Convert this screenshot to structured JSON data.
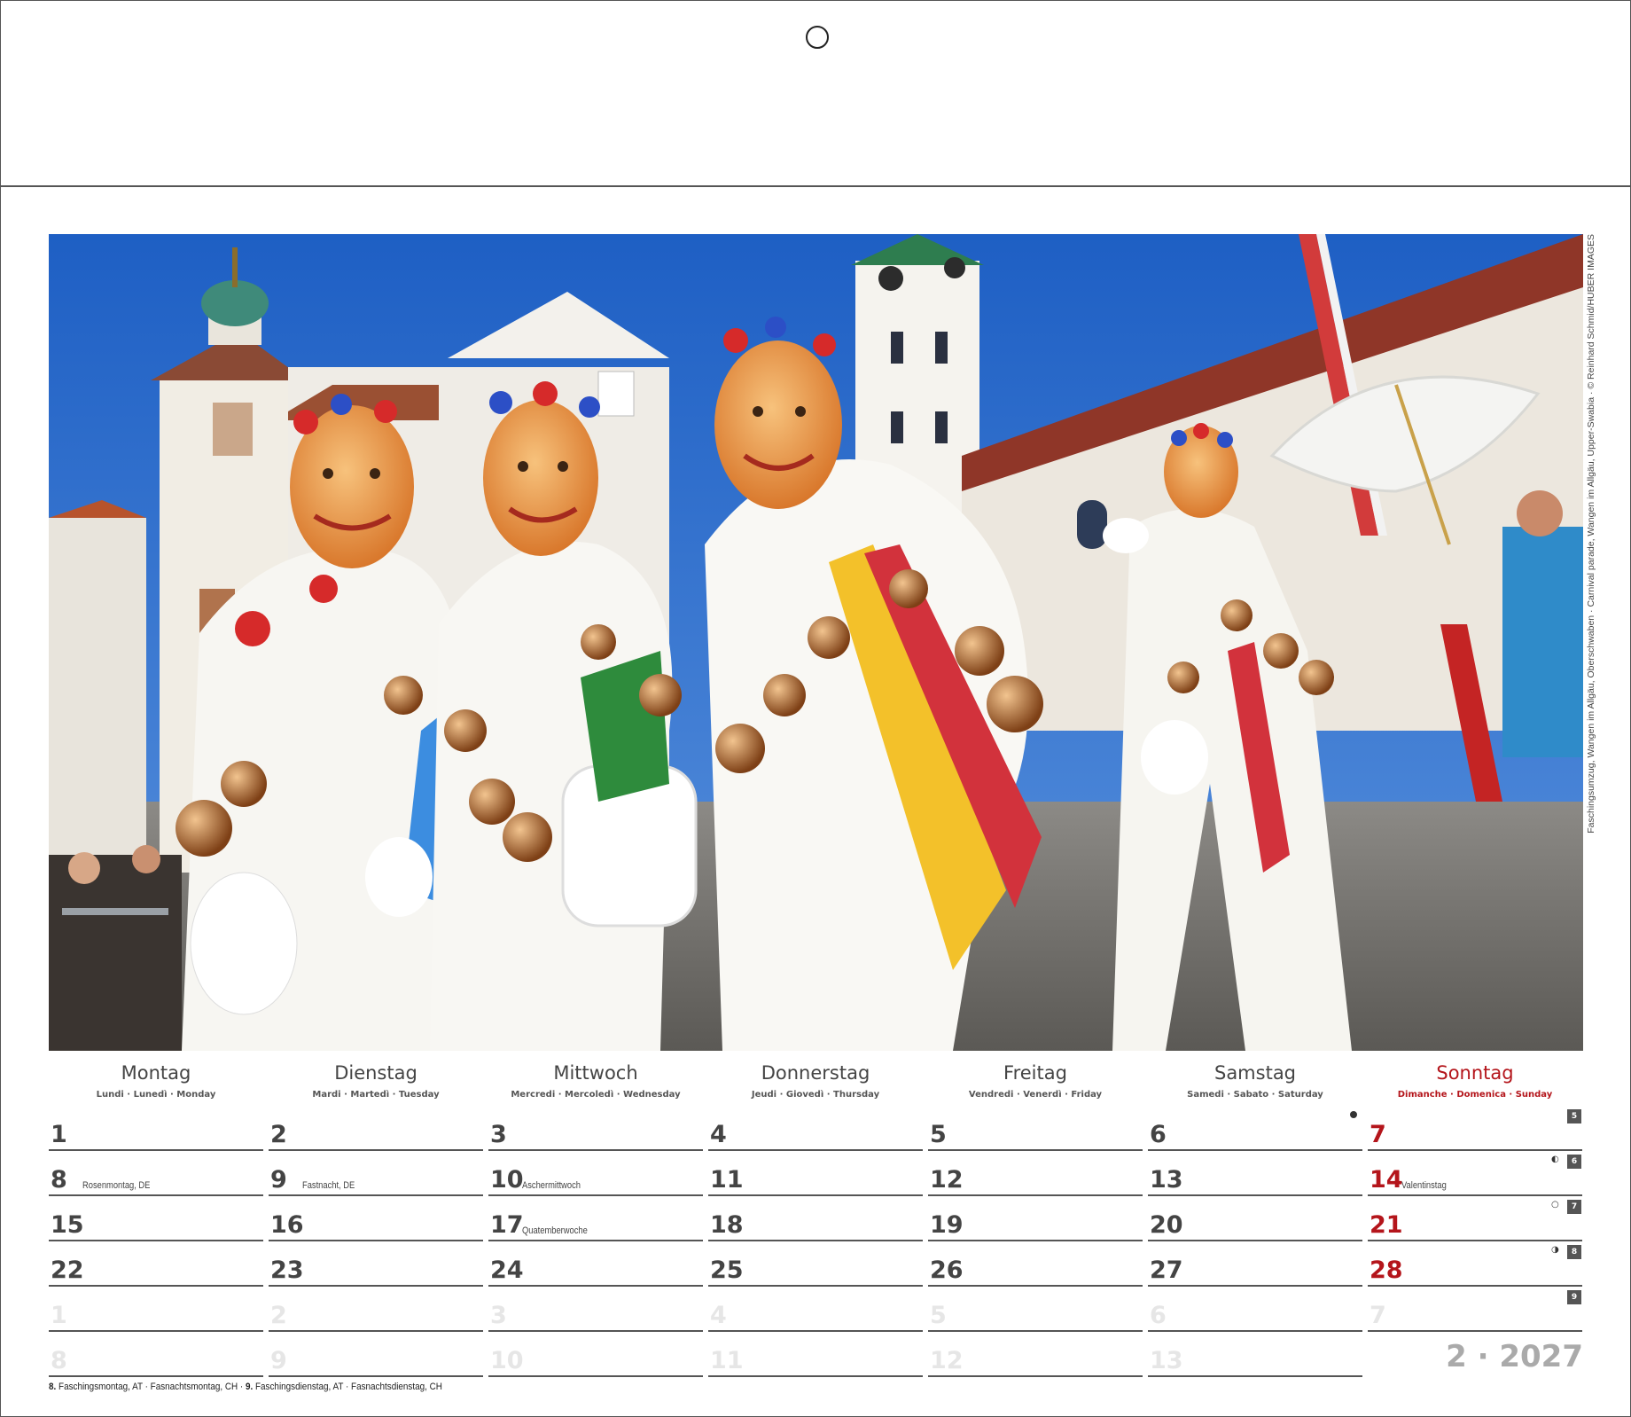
{
  "credit": "Faschingsumzug, Wangen im Allgäu, Oberschwaben · Carnival parade, Wangen im Allgäu, Upper-Swabia · © Reinhard Schmid/HUBER IMAGES",
  "weekdays": [
    {
      "name": "Montag",
      "sub": "Lundi · Lunedì · Monday"
    },
    {
      "name": "Dienstag",
      "sub": "Mardi · Martedì · Tuesday"
    },
    {
      "name": "Mittwoch",
      "sub": "Mercredi · Mercoledì · Wednesday"
    },
    {
      "name": "Donnerstag",
      "sub": "Jeudi · Giovedì · Thursday"
    },
    {
      "name": "Freitag",
      "sub": "Vendredi · Venerdì · Friday"
    },
    {
      "name": "Samstag",
      "sub": "Samedi · Sabato · Saturday"
    },
    {
      "name": "Sonntag",
      "sub": "Dimanche · Domenica · Sunday"
    }
  ],
  "weeks": [
    {
      "kw": "5",
      "days": [
        {
          "n": "1"
        },
        {
          "n": "2"
        },
        {
          "n": "3"
        },
        {
          "n": "4"
        },
        {
          "n": "5"
        },
        {
          "n": "6"
        },
        {
          "n": "7"
        }
      ]
    },
    {
      "kw": "6",
      "days": [
        {
          "n": "8",
          "note": "Rosenmontag, DE"
        },
        {
          "n": "9",
          "note": "Fastnacht, DE"
        },
        {
          "n": "10",
          "note": "Aschermittwoch"
        },
        {
          "n": "11"
        },
        {
          "n": "12"
        },
        {
          "n": "13"
        },
        {
          "n": "14",
          "note": "Valentinstag"
        }
      ]
    },
    {
      "kw": "7",
      "days": [
        {
          "n": "15"
        },
        {
          "n": "16"
        },
        {
          "n": "17",
          "note": "Quatemberwoche"
        },
        {
          "n": "18"
        },
        {
          "n": "19"
        },
        {
          "n": "20"
        },
        {
          "n": "21"
        }
      ]
    },
    {
      "kw": "8",
      "days": [
        {
          "n": "22"
        },
        {
          "n": "23"
        },
        {
          "n": "24"
        },
        {
          "n": "25"
        },
        {
          "n": "26"
        },
        {
          "n": "27"
        },
        {
          "n": "28"
        }
      ]
    },
    {
      "kw": "9",
      "days": [
        {
          "n": "1"
        },
        {
          "n": "2"
        },
        {
          "n": "3"
        },
        {
          "n": "4"
        },
        {
          "n": "5"
        },
        {
          "n": "6"
        },
        {
          "n": "7"
        }
      ]
    },
    {
      "kw": "",
      "days": [
        {
          "n": "8"
        },
        {
          "n": "9"
        },
        {
          "n": "10"
        },
        {
          "n": "11"
        },
        {
          "n": "12"
        },
        {
          "n": "13"
        }
      ]
    }
  ],
  "moon_symbols": {
    "row1": "◐",
    "row2": "○",
    "row3": "◑"
  },
  "month_year": "2 · 2027",
  "footer": {
    "d8": "8.",
    "t8a": " Faschingsmontag, AT",
    "t8b": "Fasnachtsmontag, CH",
    "d9": "9.",
    "t9a": " Faschingsdienstag, AT",
    "t9b": "Fasnachtsdienstag, CH",
    "sep": " · "
  },
  "colors": {
    "sunday_red": "#b4151b",
    "grid_line": "#555555",
    "faded_number": "#e6e6e6"
  }
}
